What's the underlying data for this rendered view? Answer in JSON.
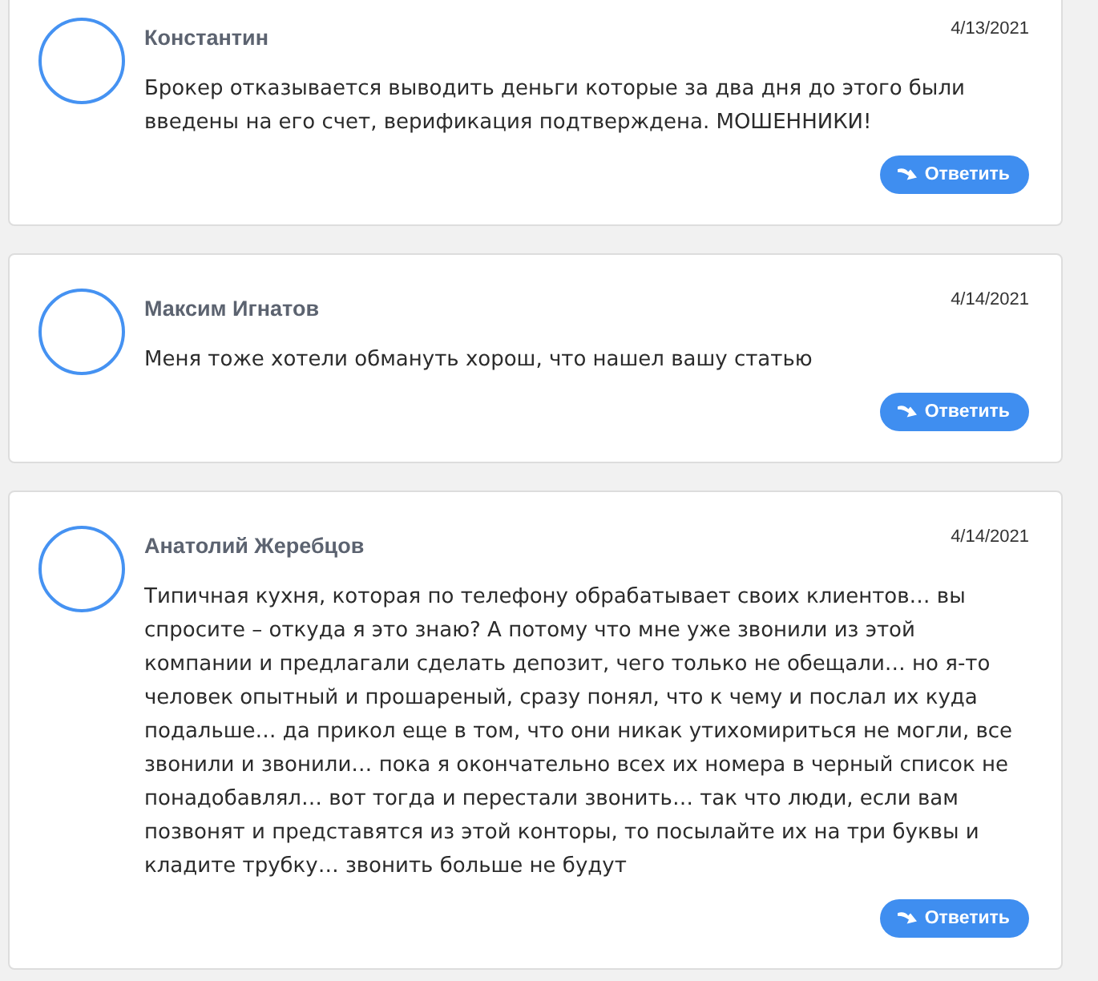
{
  "comments": [
    {
      "author": "Константин",
      "date": "4/13/2021",
      "text": "Брокер отказывается выводить деньги которые за два дня до этого были введены на его счет, верификация подтверждена. МОШЕННИКИ!",
      "reply_button": "Ответить"
    },
    {
      "author": "Максим Игнатов",
      "date": "4/14/2021",
      "text": "Меня тоже хотели обмануть хорош, что нашел вашу статью",
      "reply_button": "Ответить"
    },
    {
      "author": "Анатолий Жеребцов",
      "date": "4/14/2021",
      "text": "Типичная кухня, которая по телефону обрабатывает своих клиентов… вы спросите – откуда я это знаю? А потому что мне уже звонили из этой компании и предлагали сделать депозит, чего только не обещали… но я-то человек опытный и прошареный, сразу понял, что к чему и послал их куда подальше… да прикол еще в том, что они никак утихомириться не могли, все звонили и звонили… пока я окончательно всех их номера в черный список не понадобавлял… вот тогда и перестали звонить… так что люди, если вам позвонят и представятся из этой конторы, то посылайте их на три буквы и кладите трубку… звонить больше не будут",
      "reply_button": "Ответить"
    }
  ]
}
